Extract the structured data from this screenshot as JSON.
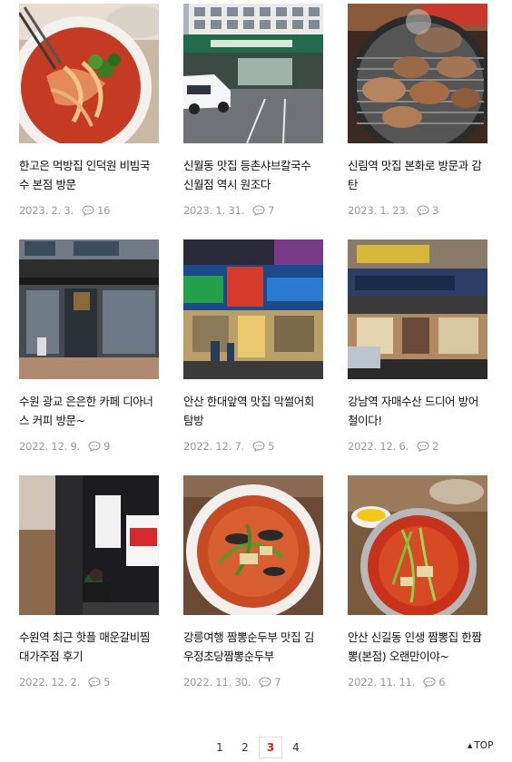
{
  "posts": [
    {
      "title": "한고은 먹방집 인덕원 비빔국수 본점 방문",
      "date": "2023. 2. 3.",
      "comments": "16",
      "image": "bibim-noodles-photo"
    },
    {
      "title": "신월동 맛집 등촌샤브칼국수 신월점 역시 원조다",
      "date": "2023. 1. 31.",
      "comments": "7",
      "image": "restaurant-building-photo"
    },
    {
      "title": "신림역 맛집 본화로 방문과 감탄",
      "date": "2023. 1. 23.",
      "comments": "3",
      "image": "grilled-meat-photo"
    },
    {
      "title": "수원 광교 은은한 카페 디아너스 커피 방문~",
      "date": "2022. 12. 9.",
      "comments": "9",
      "image": "cafe-storefront-photo"
    },
    {
      "title": "안산 한대앞역 맛집 막썰어회 탐방",
      "date": "2022. 12. 7.",
      "comments": "5",
      "image": "night-restaurant-photo"
    },
    {
      "title": "강남역 자매수산 드디어 방어철이다!",
      "date": "2022. 12. 6.",
      "comments": "2",
      "image": "seafood-restaurant-photo"
    },
    {
      "title": "수원역 최근 핫플 매운갈비찜 대가주점 후기",
      "date": "2022. 12. 2.",
      "comments": "5",
      "image": "night-alley-photo"
    },
    {
      "title": "강릉여행 짬뽕순두부 맛집 김우정초당짬뽕순두부",
      "date": "2022. 11. 30.",
      "comments": "7",
      "image": "jjamppong-tofu-photo"
    },
    {
      "title": "안산 신길동 인생 짬뽕집 한짬뽕(본점) 오랜만이야~",
      "date": "2022. 11. 11.",
      "comments": "6",
      "image": "jjamppong-bowl-photo"
    }
  ],
  "pagination": {
    "pages": [
      "1",
      "2",
      "3",
      "4"
    ],
    "current": "3"
  },
  "top_label": "TOP"
}
